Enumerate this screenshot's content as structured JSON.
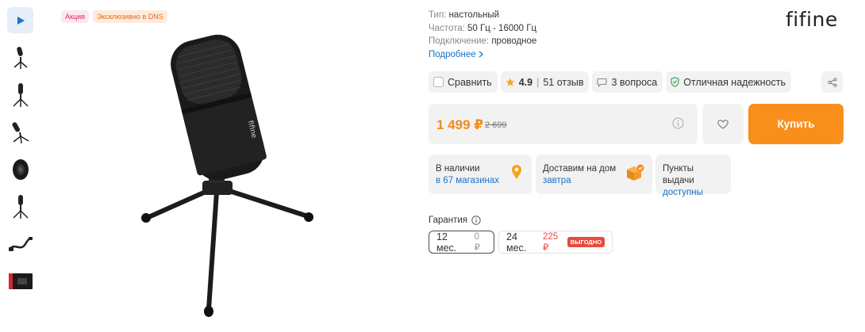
{
  "thumbnails": [
    {
      "icon": "play-icon",
      "kind": "video",
      "selected": true
    },
    {
      "icon": "microphone-tripod-photo",
      "kind": "photo"
    },
    {
      "icon": "microphone-tripod-photo",
      "kind": "photo"
    },
    {
      "icon": "microphone-tilted-photo",
      "kind": "photo"
    },
    {
      "icon": "microphone-top-view-photo",
      "kind": "photo"
    },
    {
      "icon": "microphone-tripod-photo",
      "kind": "photo"
    },
    {
      "icon": "usb-cable-photo",
      "kind": "photo"
    },
    {
      "icon": "product-box-photo",
      "kind": "photo"
    }
  ],
  "badges": {
    "sale": "Акция",
    "exclusive": "Эксклюзивно в DNS"
  },
  "brand_logo": "fifine",
  "specs": {
    "type_label": "Тип:",
    "type_value": "настольный",
    "freq_label": "Частота:",
    "freq_value": "50 Гц - 16000 Гц",
    "conn_label": "Подключение:",
    "conn_value": "проводное",
    "more": "Подробнее"
  },
  "actions": {
    "compare": "Сравнить",
    "rating": "4.9",
    "reviews": "51 отзыв",
    "questions": "3 вопроса",
    "reliability": "Отличная надежность"
  },
  "price": {
    "current": "1 499 ₽",
    "old": "2 699",
    "buy": "Купить"
  },
  "availability": {
    "stock_title": "В наличии",
    "stock_link": "в 67 магазинах",
    "delivery_title": "Доставим на дом",
    "delivery_link": "завтра",
    "pickup_title": "Пункты выдачи",
    "pickup_link": "доступны"
  },
  "warranty": {
    "title": "Гарантия",
    "options": [
      {
        "term": "12 мес.",
        "price": "0 ₽",
        "selected": true
      },
      {
        "term": "24 мес.",
        "price": "225 ₽",
        "badge": "ВЫГОДНО",
        "selected": false
      }
    ]
  },
  "colors": {
    "accent_orange": "#f98f1b",
    "link_blue": "#1a73c8",
    "sale_red": "#e84a3c"
  }
}
